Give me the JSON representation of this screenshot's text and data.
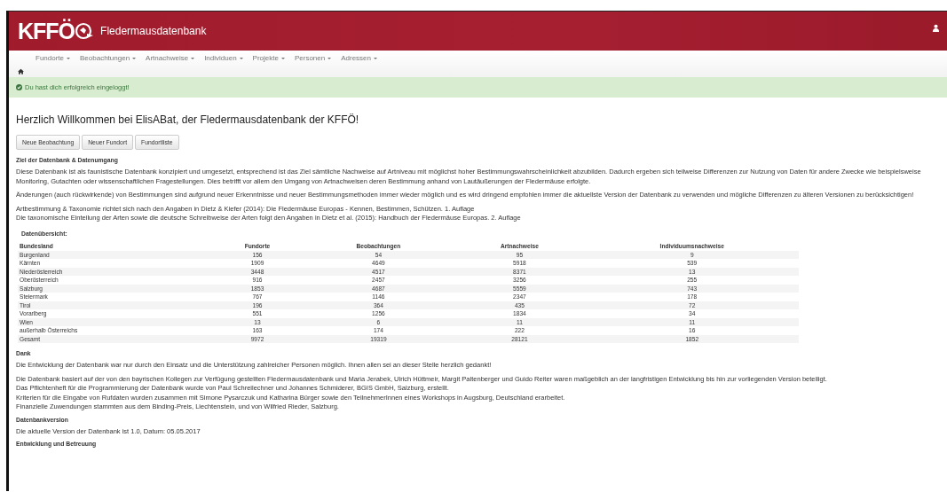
{
  "header": {
    "logo": "KFFÖ",
    "title": "Fledermausdatenbank"
  },
  "nav": [
    {
      "label": "Fundorte"
    },
    {
      "label": "Beobachtungen"
    },
    {
      "label": "Artnachweise"
    },
    {
      "label": "Individuen"
    },
    {
      "label": "Projekte"
    },
    {
      "label": "Personen"
    },
    {
      "label": "Adressen"
    }
  ],
  "alert": {
    "text": "Du hast dich erfolgreich eingeloggt!"
  },
  "heading": "Herzlich Willkommen bei ElisABat, der Fledermausdatenbank der KFFÖ!",
  "buttons": [
    "Neue Beobachtung",
    "Neuer Fundort",
    "Fundortliste"
  ],
  "sections": [
    {
      "kind": "title",
      "text": "Ziel der Datenbank & Datenumgang"
    },
    {
      "kind": "para",
      "lines": [
        "Diese Datenbank ist als faunistische Datenbank konzipiert und umgesetzt, entsprechend ist das Ziel sämtliche Nachweise auf Artniveau mit möglichst hoher Bestimmungswahrscheinlichkeit abzubilden. Dadurch ergeben sich teilweise Differenzen zur Nutzung von Daten für andere Zwecke wie beispielsweise Monitoring, Gutachten oder wissenschaftlichen Fragestellungen. Dies betrifft vor allem den Umgang von Artnachweisen deren Bestimmung anhand von Lautäußerungen der Fledermäuse erfolgte."
      ]
    },
    {
      "kind": "para",
      "lines": [
        "Änderungen (auch rückwirkende) von Bestimmungen sind aufgrund neuer Erkenntnisse und neuer Bestimmungsmethoden immer wieder möglich und es wird dringend empfohlen immer die aktuellste Version der Datenbank zu verwenden und mögliche Differenzen zu älteren Versionen zu berücksichtigen!"
      ]
    },
    {
      "kind": "para",
      "lines": [
        "Artbestimmung & Taxonomie richtet sich nach den Angaben in Dietz & Kiefer (2014): Die Fledermäuse Europas - Kennen, Bestimmen, Schützen. 1. Auflage",
        "Die taxonomische Einteilung der Arten sowie die deutsche Schreibweise der Arten folgt den Angaben in Dietz et al. (2015): Handbuch der Fledermäuse Europas. 2. Auflage"
      ]
    }
  ],
  "overview": {
    "title": "Datenübersicht:",
    "columns": [
      "Bundesland",
      "Fundorte",
      "Beobachtungen",
      "Artnachweise",
      "Individuumsnachweise"
    ],
    "rows": [
      [
        "Burgenland",
        "156",
        "54",
        "95",
        "9"
      ],
      [
        "Kärnten",
        "1909",
        "4649",
        "5918",
        "539"
      ],
      [
        "Niederösterreich",
        "3448",
        "4517",
        "8371",
        "13"
      ],
      [
        "Oberösterreich",
        "916",
        "2457",
        "3256",
        "255"
      ],
      [
        "Salzburg",
        "1853",
        "4687",
        "5559",
        "743"
      ],
      [
        "Steiermark",
        "767",
        "1146",
        "2347",
        "178"
      ],
      [
        "Tirol",
        "196",
        "364",
        "435",
        "72"
      ],
      [
        "Vorarlberg",
        "551",
        "1256",
        "1834",
        "34"
      ],
      [
        "Wien",
        "13",
        "6",
        "11",
        "11"
      ],
      [
        "außerhalb Österreichs",
        "163",
        "174",
        "222",
        "16"
      ],
      [
        "Gesamt",
        "9972",
        "19319",
        "28121",
        "1852"
      ]
    ]
  },
  "sections2": [
    {
      "kind": "title",
      "text": "Dank"
    },
    {
      "kind": "para",
      "lines": [
        "Die Entwicklung der Datenbank war nur durch den Einsatz und die Unterstützung zahlreicher Personen möglich. Ihnen allen sei an dieser Stelle herzlich gedankt!"
      ]
    },
    {
      "kind": "para",
      "lines": [
        "Die Datenbank basiert auf der von den bayrischen Kollegen zur Verfügung gestellten Fledermausdatenbank und Maria Jerabek, Ulrich Hüttmeir, Margit Paltenberger und Guido Reiter waren maßgeblich an der langfristigen Entwicklung bis hin zur vorliegenden Version beteiligt.",
        "Das Pflichtenheft für die Programmierung der Datenbank wurde von Paul Schreilechner und Johannes Schmiderer, BGIS GmbH, Salzburg, erstellt.",
        "Kriterien für die Eingabe von Rufdaten wurden zusammen mit Simone Pysarczuk und Katharina Bürger sowie den TeilnehmerInnen eines Workshops in Augsburg, Deutschland erarbeitet.",
        "Finanzielle Zuwendungen stammten aus dem Binding-Preis, Liechtenstein, und von Wilfried Rieder, Salzburg."
      ]
    },
    {
      "kind": "title",
      "text": "Datenbankversion"
    },
    {
      "kind": "para",
      "lines": [
        "Die aktuelle Version der Datenbank ist 1.0, Datum: 05.05.2017"
      ]
    },
    {
      "kind": "title",
      "text": "Entwicklung und Betreuung"
    }
  ]
}
